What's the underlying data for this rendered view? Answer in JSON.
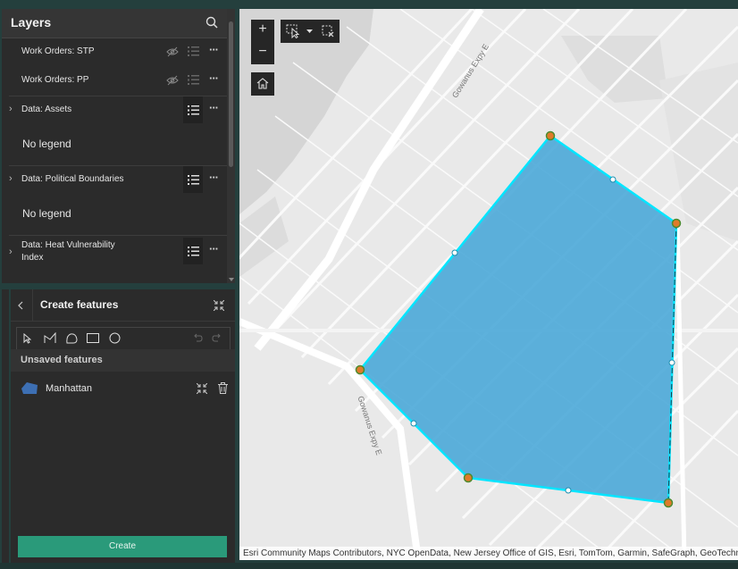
{
  "layers": {
    "title": "Layers",
    "items": [
      {
        "label": "Work Orders: STP"
      },
      {
        "label": "Work Orders: PP"
      },
      {
        "label": "Data: Assets",
        "legend": "No legend"
      },
      {
        "label": "Data: Political Boundaries",
        "legend": "No legend"
      },
      {
        "label_line1": "Data: Heat Vulnerability",
        "label_line2": "Index"
      }
    ]
  },
  "create_features": {
    "title": "Create features",
    "unsaved_label": "Unsaved features",
    "feature_name": "Manhattan",
    "create_button": "Create"
  },
  "map": {
    "road_labels": [
      "Gowanus Expy E",
      "Gowanus Expy E"
    ],
    "attribution": "Esri Community Maps Contributors, NYC OpenData, New Jersey Office of GIS, Esri, TomTom, Garmin, SafeGraph, GeoTechnologies",
    "zoom_in": "+",
    "zoom_out": "−",
    "polygon_fill": "#4ba8d8",
    "polygon_outline": "#00e5ff",
    "vertex_color": "#e07a2a"
  },
  "colors": {
    "panel_bg": "#2b2b2b",
    "accent": "#2a9a7a",
    "app_bg": "#243f3d"
  }
}
